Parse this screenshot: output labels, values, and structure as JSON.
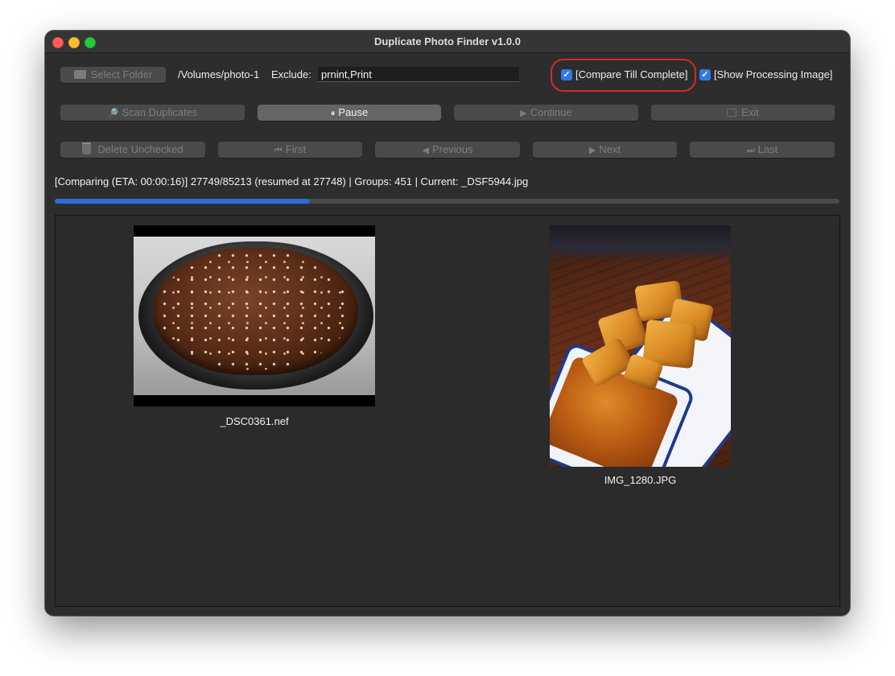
{
  "window": {
    "title": "Duplicate Photo Finder v1.0.0"
  },
  "toolbar": {
    "select_folder": {
      "label": "Select Folder",
      "icon": "folder-icon"
    },
    "folder_path": "/Volumes/photo-1",
    "exclude_label": "Exclude:",
    "exclude_value": "prnint,Print",
    "compare_till_complete": {
      "label": "[Compare Till Complete]",
      "checked": true
    },
    "show_processing_image": {
      "label": "[Show Processing Image]",
      "checked": true
    }
  },
  "actions": {
    "scan": {
      "label": "Scan Duplicates",
      "icon": "magnifier-icon",
      "glyph": "🔎"
    },
    "pause": {
      "label": "Pause",
      "glyph": "⏸"
    },
    "continue": {
      "label": "Continue",
      "glyph": "▶"
    },
    "exit": {
      "label": "Exit",
      "icon": "exit-icon"
    }
  },
  "navigation": {
    "delete_unchecked": {
      "label": "Delete Unchecked",
      "icon": "trash-icon"
    },
    "first": {
      "label": "First",
      "glyph": "⏮"
    },
    "previous": {
      "label": "Previous",
      "glyph": "◀"
    },
    "next": {
      "label": "Next",
      "glyph": "▶"
    },
    "last": {
      "label": "Last",
      "glyph": "⏭"
    }
  },
  "status": {
    "text": "[Comparing (ETA: 00:00:16)] 27749/85213 (resumed at 27748) | Groups: 451 | Current: _DSF5944.jpg",
    "progress_fraction": 0.325
  },
  "results": [
    {
      "filename": "_DSC0361.nef"
    },
    {
      "filename": "IMG_1280.JPG"
    }
  ],
  "colors": {
    "accent": "#2f7ae5",
    "progress": "#2b6fd6",
    "highlight": "#d42a2a",
    "window_bg": "#2d2d2d"
  }
}
